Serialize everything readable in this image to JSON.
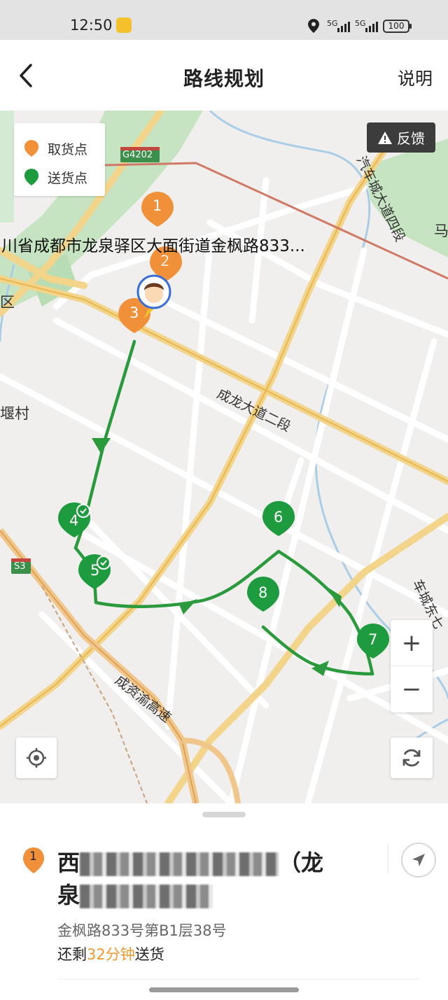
{
  "status_bar": {
    "time": "12:50",
    "signal_1": "5G",
    "signal_2": "5G",
    "battery": "100"
  },
  "header": {
    "title": "路线规划",
    "help": "说明"
  },
  "map": {
    "legend": {
      "pickup_label": "取货点",
      "delivery_label": "送货点"
    },
    "feedback_label": "反馈",
    "labels": {
      "highway_shield": "G4202",
      "s3_shield": "S3",
      "address_callout": "川省成都市龙泉驿区大面街道金枫路833...",
      "road_chenglong": "成龙大道二段",
      "road_qiche": "汽车城大道四段",
      "road_chengzi": "成资渝高速",
      "road_chechengdong": "车城东七",
      "village": "堰村",
      "district": "区",
      "ma": "马"
    },
    "markers": [
      {
        "label": "1",
        "type": "pickup"
      },
      {
        "label": "2",
        "type": "pickup"
      },
      {
        "label": "3",
        "type": "pickup"
      },
      {
        "label": "4",
        "type": "delivery",
        "done": true
      },
      {
        "label": "5",
        "type": "delivery",
        "done": true
      },
      {
        "label": "6",
        "type": "delivery"
      },
      {
        "label": "7",
        "type": "delivery"
      },
      {
        "label": "8",
        "type": "delivery"
      }
    ],
    "zoom_in": "+",
    "zoom_out": "−",
    "colors": {
      "pickup": "#f0913a",
      "delivery": "#1e9b3e",
      "route": "#2a9a3c"
    }
  },
  "sheet": {
    "index": "1",
    "name_line1_start": "西",
    "name_line1_end": "（龙",
    "name_line2_start": "泉",
    "address": "金枫路833号第B1层38号",
    "remaining_prefix": "还剩",
    "remaining_time": "32分钟",
    "remaining_suffix": "送货"
  }
}
